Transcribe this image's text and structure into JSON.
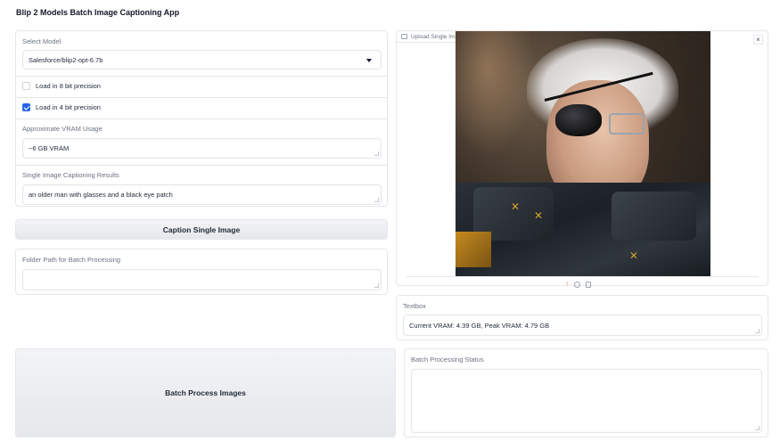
{
  "app": {
    "title": "Blip 2 Models Batch Image Captioning App"
  },
  "model": {
    "label": "Select Model",
    "selected": "Salesforce/blip2-opt-6.7b"
  },
  "precision": {
    "load_8bit_label": "Load in 8 bit precision",
    "load_8bit_checked": false,
    "load_4bit_label": "Load in 4 bit precision",
    "load_4bit_checked": true
  },
  "vram": {
    "label": "Approximate VRAM Usage",
    "value": "~6 GB VRAM"
  },
  "single_result": {
    "label": "Single Image Captioning Results",
    "value": "an older man with glasses and a black eye patch"
  },
  "buttons": {
    "caption_single": "Caption Single Image",
    "batch_process": "Batch Process Images"
  },
  "folder": {
    "label": "Folder Path for Batch Processing",
    "value": ""
  },
  "upload": {
    "label": "Upload Single Image"
  },
  "textbox": {
    "label": "Textbox",
    "value": "Current VRAM: 4.39 GB, Peak VRAM: 4.79 GB"
  },
  "batch_status": {
    "label": "Batch Processing Status",
    "value": ""
  },
  "colors": {
    "accent": "#2563eb",
    "upload_icon": "#f97316",
    "border": "#e5e7eb"
  }
}
